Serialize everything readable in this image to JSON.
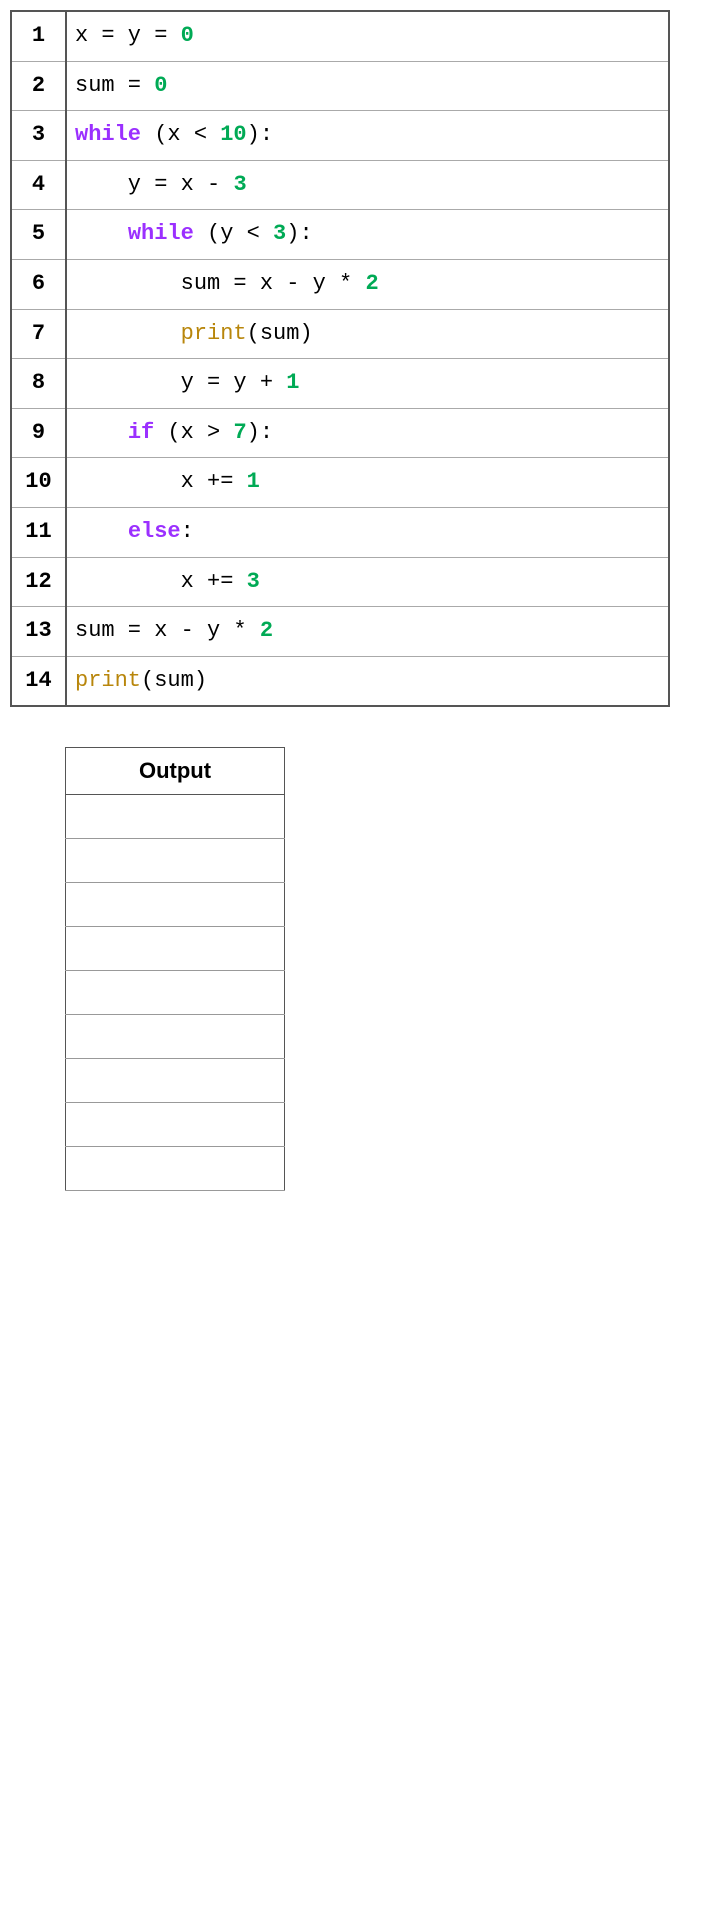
{
  "code": {
    "lines": [
      {
        "num": "1",
        "html": "x = y = <span class=\"num\">0</span>"
      },
      {
        "num": "2",
        "html": "sum = <span class=\"num\">0</span>"
      },
      {
        "num": "3",
        "html": "<span class=\"kw-while\">while</span> (x &lt; <span class=\"num\">10</span>):"
      },
      {
        "num": "4",
        "html": "&nbsp;&nbsp;&nbsp; y = x - <span class=\"num\">3</span>"
      },
      {
        "num": "5",
        "html": "&nbsp;&nbsp;&nbsp; <span class=\"kw-while\">while</span> (y &lt; <span class=\"num\">3</span>):"
      },
      {
        "num": "6",
        "html": "&nbsp;&nbsp;&nbsp;&nbsp;&nbsp;&nbsp;&nbsp; sum = x - y * <span class=\"num\">2</span>"
      },
      {
        "num": "7",
        "html": "&nbsp;&nbsp;&nbsp;&nbsp;&nbsp;&nbsp;&nbsp; <span class=\"kw-print\">print</span>(sum)"
      },
      {
        "num": "8",
        "html": "&nbsp;&nbsp;&nbsp;&nbsp;&nbsp;&nbsp;&nbsp; y = y + <span class=\"num\">1</span>"
      },
      {
        "num": "9",
        "html": "&nbsp;&nbsp;&nbsp; <span class=\"kw-if\">if</span> (x &gt; <span class=\"num\">7</span>):"
      },
      {
        "num": "10",
        "html": "&nbsp;&nbsp;&nbsp;&nbsp;&nbsp;&nbsp;&nbsp; x += <span class=\"num\">1</span>"
      },
      {
        "num": "11",
        "html": "&nbsp;&nbsp;&nbsp; <span class=\"kw-else\">else</span>:"
      },
      {
        "num": "12",
        "html": "&nbsp;&nbsp;&nbsp;&nbsp;&nbsp;&nbsp;&nbsp; x += <span class=\"num\">3</span>"
      },
      {
        "num": "13",
        "html": "sum = x - y * <span class=\"num\">2</span>"
      },
      {
        "num": "14",
        "html": "<span class=\"kw-print\">print</span>(sum)"
      }
    ]
  },
  "output": {
    "header": "Output",
    "rows": 9
  }
}
